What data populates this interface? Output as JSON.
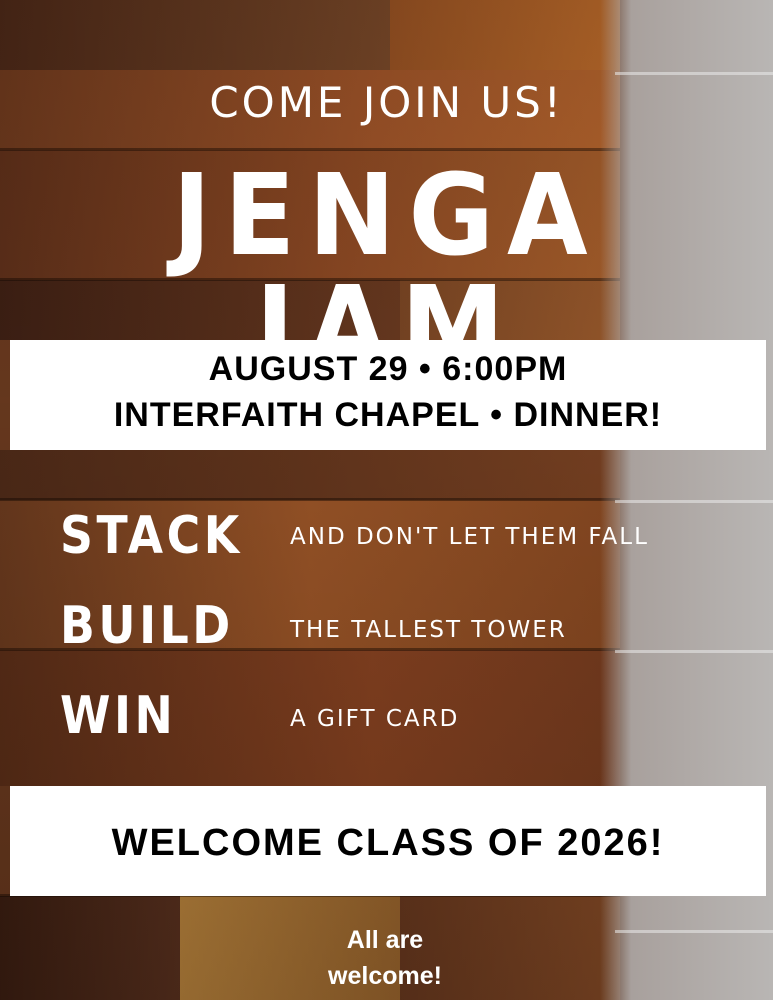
{
  "flyer": {
    "tagline": "COME JOIN US!",
    "title": "JENGA JAM",
    "event_line_1": "AUGUST 29 • 6:00PM",
    "event_line_2": "INTERFAITH CHAPEL • DINNER!",
    "activities": [
      {
        "word": "STACK",
        "description": "AND DON'T LET THEM FALL"
      },
      {
        "word": "BUILD",
        "description": "THE TALLEST TOWER"
      },
      {
        "word": "WIN",
        "description": "A GIFT CARD"
      }
    ],
    "welcome": "WELCOME CLASS OF 2026!",
    "footer_line_1": "All are",
    "footer_line_2": "welcome!"
  },
  "colors": {
    "wood_dark": "#5a2e16",
    "wood_mid": "#8a4a22",
    "wood_light": "#b0652c",
    "side_gray": "#b9b6b4",
    "panel": "#ffffff",
    "panel_text": "#000000",
    "overlay_text": "#ffffff"
  }
}
